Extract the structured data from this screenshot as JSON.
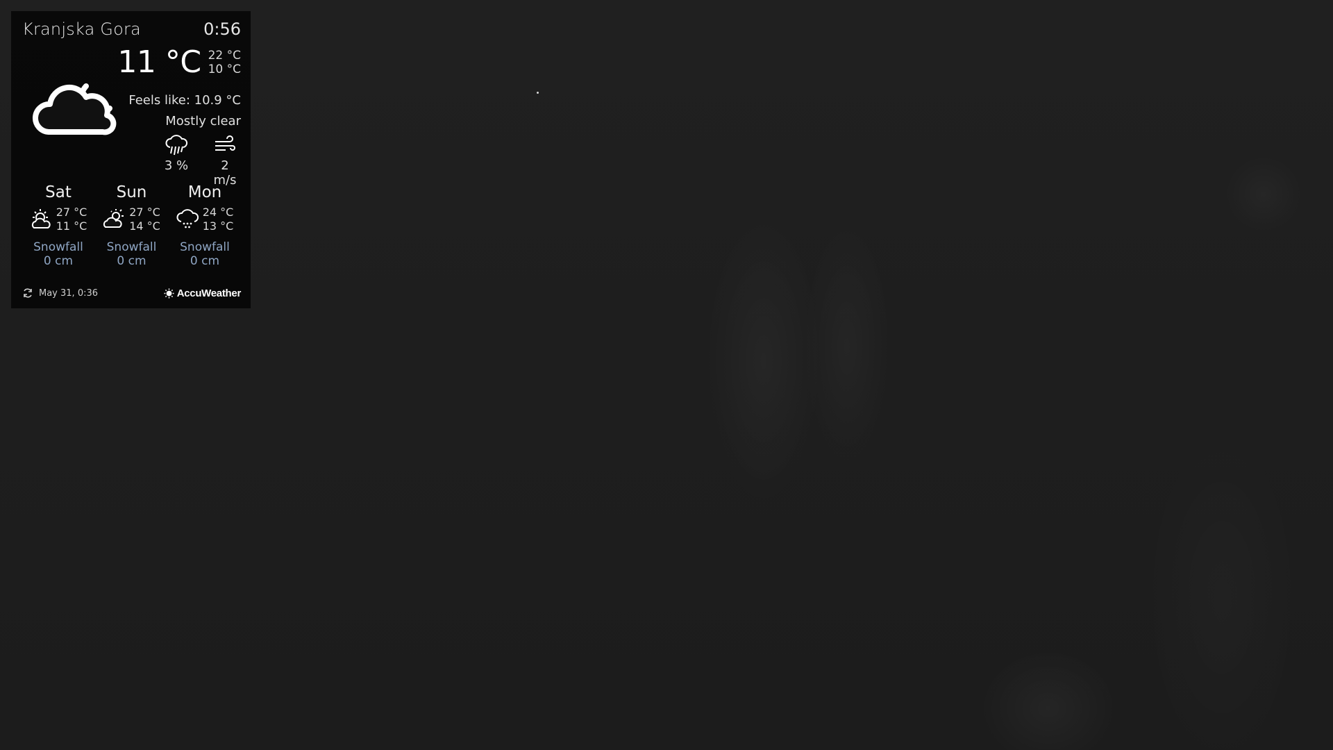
{
  "widget": {
    "location": "Kranjska Gora",
    "time": "0:56",
    "current": {
      "icon": "cloud-moon-icon",
      "temperature": "11 °C",
      "high": "22 °C",
      "low": "10 °C",
      "feels_like": "Feels like: 10.9 °C",
      "condition": "Mostly clear",
      "precipitation": {
        "icon": "rain-cloud-icon",
        "value": "3 %"
      },
      "wind": {
        "icon": "wind-icon",
        "value": "2 m/s"
      }
    },
    "forecast": [
      {
        "day": "Sat",
        "icon": "partly-sunny-icon",
        "high": "27 °C",
        "low": "11 °C",
        "snow_label": "Snowfall",
        "snow_value": "0 cm"
      },
      {
        "day": "Sun",
        "icon": "sun-behind-cloud-icon",
        "high": "27 °C",
        "low": "14 °C",
        "snow_label": "Snowfall",
        "snow_value": "0 cm"
      },
      {
        "day": "Mon",
        "icon": "showers-icon",
        "high": "24 °C",
        "low": "13 °C",
        "snow_label": "Snowfall",
        "snow_value": "0 cm"
      }
    ],
    "footer": {
      "refresh_icon": "refresh-icon",
      "updated": "May 31, 0:36",
      "brand": "AccuWeather",
      "brand_icon": "accuweather-sun-icon"
    },
    "colors": {
      "snow_text": "#8fa6c4",
      "panel_bg": "#000000"
    }
  }
}
